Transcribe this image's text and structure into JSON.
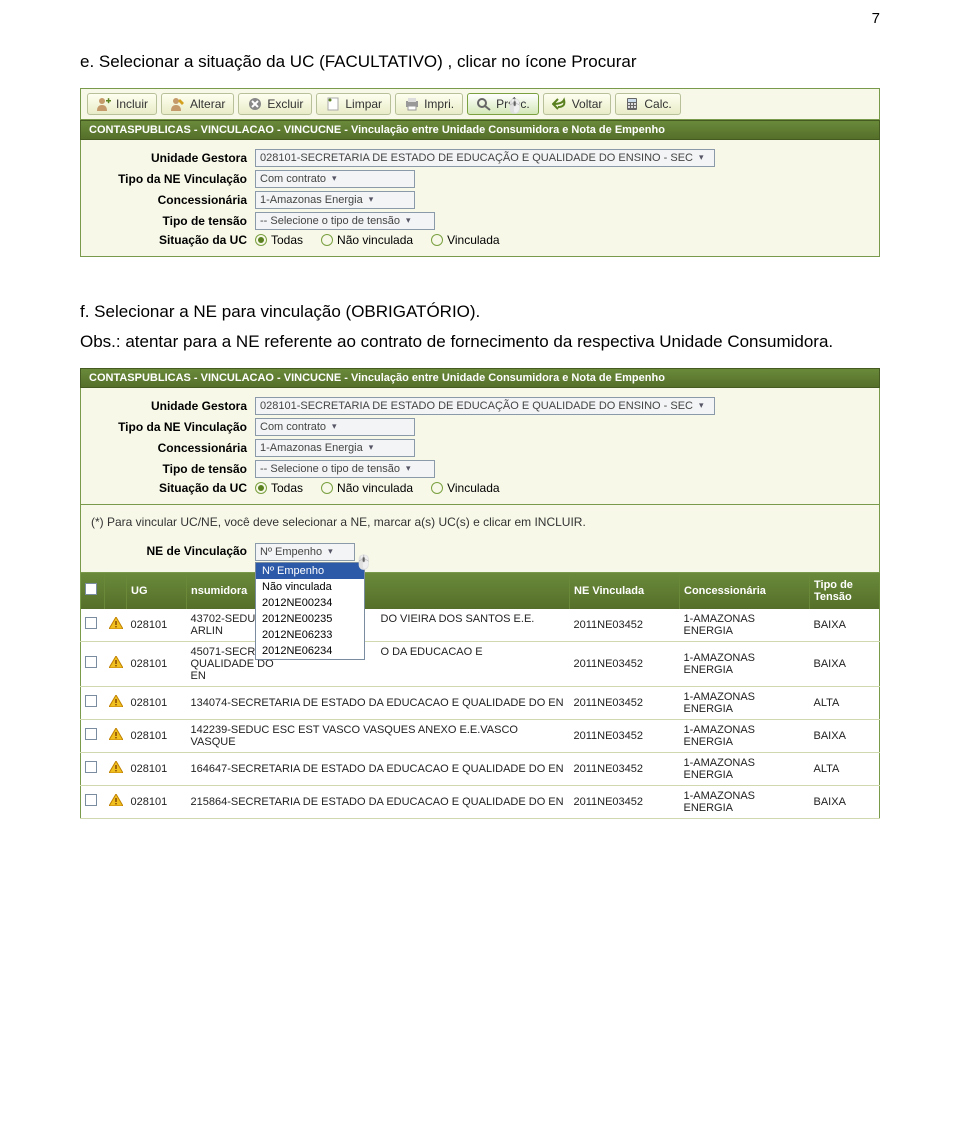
{
  "page_number": "7",
  "text_e": "e. Selecionar  a situação da UC (FACULTATIVO) , clicar no ícone Procurar",
  "text_f": "f.  Selecionar a NE para vinculação (OBRIGATÓRIO).",
  "text_obs": "Obs.: atentar para a NE referente ao contrato de fornecimento da respectiva Unidade Consumidora.",
  "toolbar": {
    "incluir": "Incluir",
    "alterar": "Alterar",
    "excluir": "Excluir",
    "limpar": "Limpar",
    "impri": "Impri.",
    "proc": "Pr�c.",
    "voltar": "Voltar",
    "calc": "Calc."
  },
  "breadcrumb": "CONTASPUBLICAS - VINCULACAO - VINCUCNE - Vinculação entre Unidade Consumidora e Nota de Empenho",
  "form": {
    "ug_label": "Unidade Gestora",
    "ug_value": "028101-SECRETARIA DE ESTADO DE EDUCAÇÃO E QUALIDADE DO ENSINO - SEC",
    "tipo_ne_label": "Tipo da NE Vinculação",
    "tipo_ne_value": "Com contrato",
    "conc_label": "Concessionária",
    "conc_value": "1-Amazonas Energia",
    "tensao_label": "Tipo de tensão",
    "tensao_value": "-- Selecione o tipo de tensão",
    "sit_label": "Situação da UC",
    "r_todas": "Todas",
    "r_nao": "Não vinculada",
    "r_vinc": "Vinculada"
  },
  "note_text": "(*) Para vincular UC/NE, você deve selecionar a NE, marcar a(s) UC(s) e clicar em INCLUIR.",
  "ne_vinc_label": "NE de Vinculação",
  "ne_vinc_value": "Nº Empenho",
  "dropdown": {
    "i0": "Nº Empenho",
    "i1": "Não vinculada",
    "i2": "2012NE00234",
    "i3": "2012NE00235",
    "i4": "2012NE06233",
    "i5": "2012NE06234"
  },
  "headers": {
    "ug": "UG",
    "cons": "nsumidora",
    "ne": "NE Vinculada",
    "conc": "Concessionária",
    "tensao": "Tipo de Tensão"
  },
  "rows": [
    {
      "ug": "028101",
      "uc_a": "43702-SEDU",
      "uc_b": "ARLIN",
      "uc_suf": "DO VIEIRA DOS SANTOS E.E.",
      "ne": "2011NE03452",
      "conc": "1-AMAZONAS ENERGIA",
      "tensao": "BAIXA"
    },
    {
      "ug": "028101",
      "uc_a": "45071-SECR",
      "uc_b": "QUALIDADE DO EN",
      "uc_suf": "O DA EDUCACAO E",
      "ne": "2011NE03452",
      "conc": "1-AMAZONAS ENERGIA",
      "tensao": "BAIXA"
    },
    {
      "ug": "028101",
      "uc_a": "134074-SECRETARIA DE ESTADO DA EDUCACAO E QUALIDADE DO EN",
      "uc_b": "",
      "uc_suf": "",
      "ne": "2011NE03452",
      "conc": "1-AMAZONAS ENERGIA",
      "tensao": "ALTA"
    },
    {
      "ug": "028101",
      "uc_a": "142239-SEDUC ESC EST VASCO VASQUES ANEXO E.E.VASCO VASQUE",
      "uc_b": "",
      "uc_suf": "",
      "ne": "2011NE03452",
      "conc": "1-AMAZONAS ENERGIA",
      "tensao": "BAIXA"
    },
    {
      "ug": "028101",
      "uc_a": "164647-SECRETARIA DE ESTADO DA EDUCACAO E QUALIDADE DO EN",
      "uc_b": "",
      "uc_suf": "",
      "ne": "2011NE03452",
      "conc": "1-AMAZONAS ENERGIA",
      "tensao": "ALTA"
    },
    {
      "ug": "028101",
      "uc_a": "215864-SECRETARIA DE ESTADO DA EDUCACAO E QUALIDADE DO EN",
      "uc_b": "",
      "uc_suf": "",
      "ne": "2011NE03452",
      "conc": "1-AMAZONAS ENERGIA",
      "tensao": "BAIXA"
    }
  ]
}
